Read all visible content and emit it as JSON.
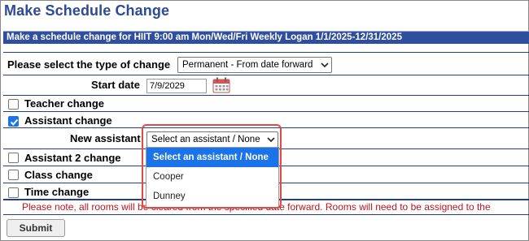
{
  "page": {
    "title": "Make Schedule Change",
    "banner": "Make a schedule change for HIIT 9:00 am Mon/Wed/Fri Weekly Logan 1/1/2025-12/31/2025"
  },
  "change_type": {
    "label": "Please select the type of change",
    "selected": "Permanent - From date forward"
  },
  "start_date": {
    "label": "Start date",
    "value": "7/9/2029"
  },
  "options": {
    "teacher": {
      "label": "Teacher change",
      "checked": false
    },
    "assistant": {
      "label": "Assistant change",
      "checked": true
    },
    "assistant2": {
      "label": "Assistant 2 change",
      "checked": false
    },
    "class": {
      "label": "Class change",
      "checked": false
    },
    "time": {
      "label": "Time change",
      "checked": false
    }
  },
  "new_assistant": {
    "label": "New assistant",
    "selected": "Select an assistant / None",
    "choices": [
      "Select an assistant / None",
      "Cooper",
      "Dunney"
    ]
  },
  "notice": "Please note, all rooms will be cleared from the specified date forward. Rooms will need to be assigned to the",
  "actions": {
    "submit": "Submit"
  },
  "colors": {
    "title": "#2b4a9a",
    "banner": "#2f4f9e",
    "notice": "#c0141c",
    "highlight": "#e04a44",
    "selection": "#1a73e8"
  },
  "icons": {
    "date_picker": "calendar-icon",
    "select_arrow": "chevron-down-icon",
    "checked": "checkmark-icon"
  }
}
